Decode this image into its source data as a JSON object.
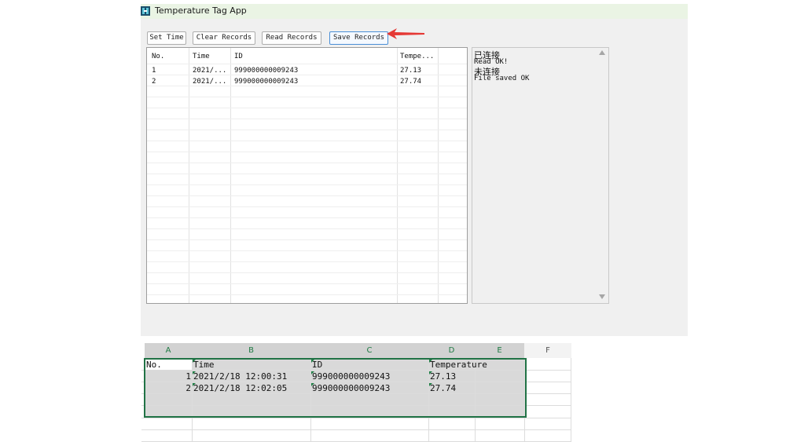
{
  "window": {
    "title": "Temperature Tag App"
  },
  "toolbar": {
    "set_time": "Set Time",
    "clear_records": "Clear Records",
    "read_records": "Read Records",
    "save_records": "Save Records"
  },
  "grid": {
    "headers": [
      "No.",
      "Time",
      "ID",
      "Tempe..."
    ],
    "rows": [
      [
        "1",
        "2021/...",
        "999000000009243",
        "27.13"
      ],
      [
        "2",
        "2021/...",
        "999000000009243",
        "27.74"
      ]
    ]
  },
  "log": {
    "lines": [
      "已连接",
      "Read OK!",
      "未连接",
      "File saved OK"
    ]
  },
  "sheet": {
    "columns": [
      "A",
      "B",
      "C",
      "D",
      "E",
      "F"
    ],
    "header_row": [
      "No.",
      "Time",
      "ID",
      "Temperature"
    ],
    "rows": [
      [
        "1",
        "2021/2/18 12:00:31",
        "999000000009243",
        "27.13"
      ],
      [
        "2",
        "2021/2/18 12:02:05",
        "999000000009243",
        "27.74"
      ]
    ]
  },
  "colors": {
    "titlebar": "#eaf4e4",
    "window_bg": "#f0f0f0",
    "selection_border": "#217346",
    "column_header_selected": "#1d7a42",
    "annotation_arrow": "#e53935"
  },
  "icons": {
    "app": "app-logo-icon",
    "annotation": "red-arrow-icon"
  }
}
